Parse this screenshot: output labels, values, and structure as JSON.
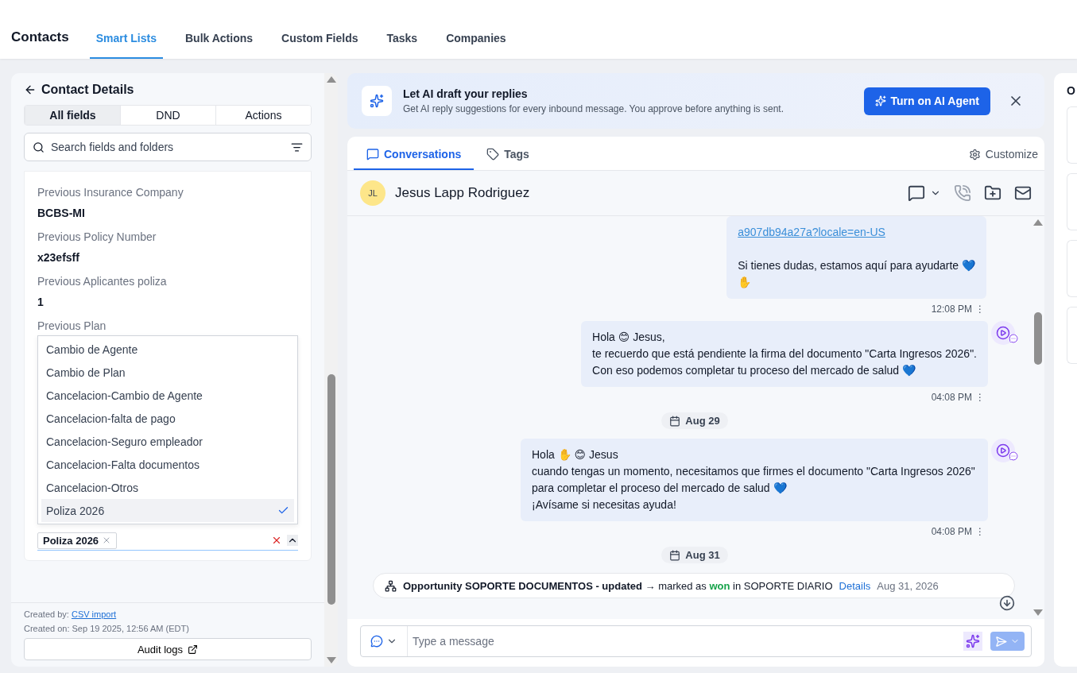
{
  "header": {
    "title": "Contacts",
    "tabs": [
      {
        "label": "Smart Lists",
        "selected": true
      },
      {
        "label": "Bulk Actions",
        "selected": false
      },
      {
        "label": "Custom Fields",
        "selected": false
      },
      {
        "label": "Tasks",
        "selected": false
      },
      {
        "label": "Companies",
        "selected": false
      }
    ]
  },
  "contact_panel": {
    "title": "Contact Details",
    "tabs": [
      {
        "label": "All fields",
        "selected": true
      },
      {
        "label": "DND",
        "selected": false
      },
      {
        "label": "Actions",
        "selected": false
      }
    ],
    "search": {
      "placeholder": "Search fields and folders"
    },
    "fields": [
      {
        "label": "Previous Insurance Company",
        "value": "BCBS-MI"
      },
      {
        "label": "Previous Policy Number",
        "value": "x23efsff"
      },
      {
        "label": "Previous Aplicantes poliza",
        "value": "1"
      }
    ],
    "plan_field": {
      "label": "Previous Plan",
      "options": [
        {
          "label": "Cambio de Agente",
          "selected": false
        },
        {
          "label": "Cambio de Plan",
          "selected": false
        },
        {
          "label": "Cancelacion-Cambio de Agente",
          "selected": false
        },
        {
          "label": "Cancelacion-falta de pago",
          "selected": false
        },
        {
          "label": "Cancelacion-Seguro empleador",
          "selected": false
        },
        {
          "label": "Cancelacion-Falta documentos",
          "selected": false
        },
        {
          "label": "Cancelacion-Otros",
          "selected": false
        },
        {
          "label": "Poliza 2026",
          "selected": true
        }
      ],
      "tags": [
        "Poliza 2026"
      ]
    },
    "created_by_label": "Created by:",
    "created_by": "CSV import",
    "created_on": "Created on: Sep 19 2025, 12:56 AM (EDT)",
    "audit_button": "Audit logs"
  },
  "ai_banner": {
    "title": "Let AI draft your replies",
    "text": "Get AI reply suggestions for every inbound message. You approve before anything is sent.",
    "button": "Turn on AI Agent"
  },
  "conversation": {
    "tabs": [
      {
        "label": "Conversations",
        "selected": true
      },
      {
        "label": "Tags",
        "selected": false
      }
    ],
    "customize": "Customize",
    "contact": {
      "initials": "JL",
      "name": "Jesus Lapp Rodriguez"
    },
    "items": [
      {
        "kind": "message",
        "link": "a907db94a27a?locale=en-US",
        "lines": [
          "Si tienes dudas, estamos aquí para ayudarte 💙",
          "✋"
        ],
        "time": "12:08 PM",
        "menu": "⋮",
        "avatar": false
      },
      {
        "kind": "message",
        "lines": [
          "Hola 😊 Jesus,",
          "te recuerdo que está pendiente la firma del documento \"Carta Ingresos 2026\".",
          "Con eso podemos completar tu proceso del mercado de salud 💙"
        ],
        "time": "04:08 PM",
        "menu": "⋮",
        "avatar": true
      },
      {
        "kind": "date",
        "label": "Aug 29"
      },
      {
        "kind": "message",
        "lines": [
          "Hola ✋ 😊 Jesus",
          "cuando tengas un momento, necesitamos que firmes el documento \"Carta Ingresos 2026\" para completar el proceso del mercado de salud 💙",
          "¡Avísame si necesitas ayuda!"
        ],
        "time": "04:08 PM",
        "menu": "⋮",
        "avatar": true
      },
      {
        "kind": "date",
        "label": "Aug 31"
      },
      {
        "kind": "activity",
        "text": "**Opportunity SOPORTE DOCUMENTOS - updated** → marked as",
        "status": "won",
        "after": "in SOPORTE DIARIO",
        "link": "Details",
        "date": "Aug 31, 2026"
      }
    ],
    "composer": {
      "placeholder": "Type a message"
    }
  },
  "right_panel": {
    "heading": "O"
  }
}
